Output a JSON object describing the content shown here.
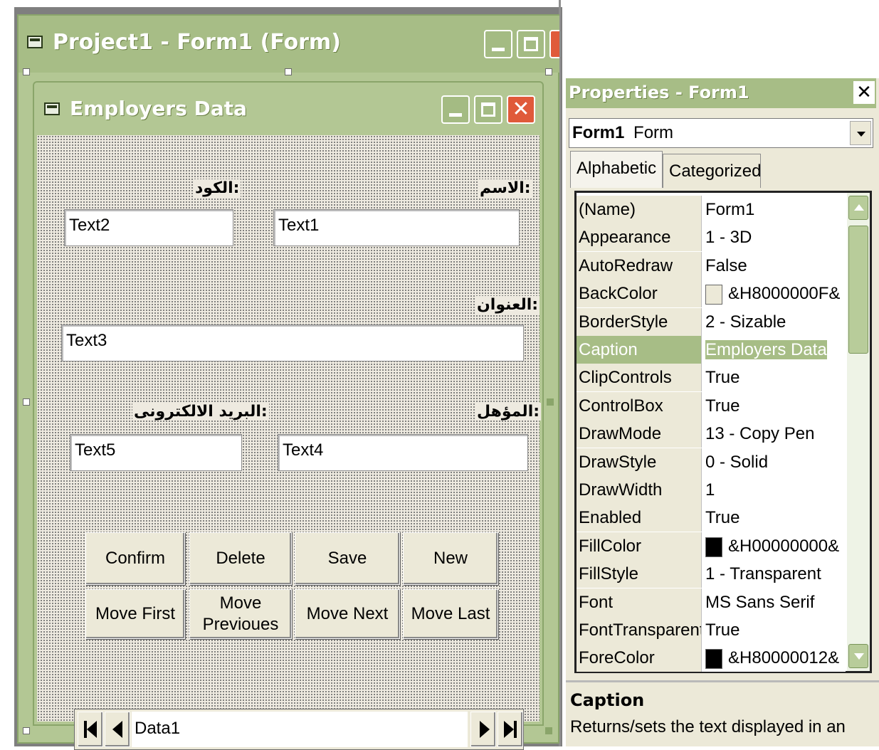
{
  "outer_window": {
    "title": "Project1 - Form1 (Form)"
  },
  "form_window": {
    "title": "Employers Data",
    "labels": {
      "code": ":الكود",
      "name": ":الاسم",
      "address": ":العنوان",
      "email": ":البريد الالكترونى",
      "qualification": ":المؤهل"
    },
    "textboxes": {
      "text2": "Text2",
      "text1": "Text1",
      "text3": "Text3",
      "text5": "Text5",
      "text4": "Text4"
    },
    "buttons": {
      "confirm": "Confirm",
      "delete": "Delete",
      "save": "Save",
      "new": "New",
      "move_first": "Move First",
      "move_previous": "Move\nPrevioues",
      "move_next": "Move Next",
      "move_last": "Move Last"
    },
    "data_control": {
      "caption": "Data1"
    }
  },
  "properties": {
    "title": "Properties - Form1",
    "close_glyph": "✕",
    "object_combo": {
      "name": "Form1",
      "type": "Form"
    },
    "tabs": [
      "Alphabetic",
      "Categorized"
    ],
    "rows": [
      {
        "name": "(Name)",
        "value": "Form1"
      },
      {
        "name": "Appearance",
        "value": "1 - 3D"
      },
      {
        "name": "AutoRedraw",
        "value": "False"
      },
      {
        "name": "BackColor",
        "value": "&H8000000F&",
        "swatch": "#ece9d8"
      },
      {
        "name": "BorderStyle",
        "value": "2 - Sizable"
      },
      {
        "name": "Caption",
        "value": "Employers Data",
        "selected": true
      },
      {
        "name": "ClipControls",
        "value": "True"
      },
      {
        "name": "ControlBox",
        "value": "True"
      },
      {
        "name": "DrawMode",
        "value": "13 - Copy Pen"
      },
      {
        "name": "DrawStyle",
        "value": "0 - Solid"
      },
      {
        "name": "DrawWidth",
        "value": "1"
      },
      {
        "name": "Enabled",
        "value": "True"
      },
      {
        "name": "FillColor",
        "value": "&H00000000&",
        "swatch": "#000000"
      },
      {
        "name": "FillStyle",
        "value": "1 - Transparent"
      },
      {
        "name": "Font",
        "value": "MS Sans Serif"
      },
      {
        "name": "FontTransparent",
        "value": "True"
      },
      {
        "name": "ForeColor",
        "value": "&H80000012&",
        "swatch": "#000000"
      }
    ],
    "description": {
      "title": "Caption",
      "text": "Returns/sets the text displayed in an"
    }
  },
  "colors": {
    "title_bar": "#a7bd86",
    "close_button": "#e05a3a",
    "form_background": "#eeeae0"
  }
}
